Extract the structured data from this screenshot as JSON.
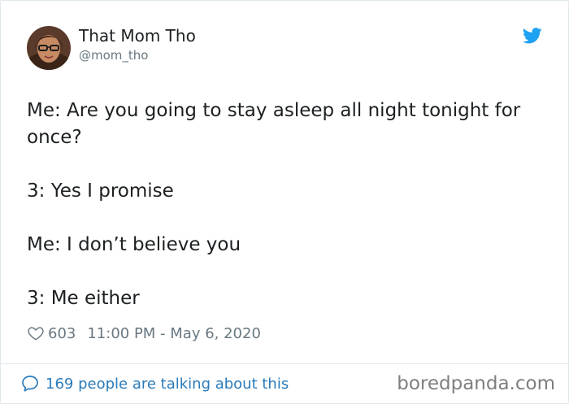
{
  "user": {
    "display_name": "That Mom Tho",
    "handle": "@mom_tho",
    "avatar_icon": "profile-photo"
  },
  "brand": {
    "icon": "twitter-bird-icon",
    "color": "#1da1f2"
  },
  "tweet": {
    "lines": [
      "Me: Are you going to stay asleep all night tonight for once?",
      "3: Yes I promise",
      "Me: I don’t believe you",
      "3: Me either"
    ]
  },
  "meta": {
    "like_icon": "heart-icon",
    "likes": "603",
    "timestamp": "11:00 PM - May 6, 2020"
  },
  "footer": {
    "reply_icon": "speech-bubble-icon",
    "conversation_text": "169 people are talking about this",
    "link_color": "#2b7bb9",
    "watermark": "boredpanda.com"
  }
}
